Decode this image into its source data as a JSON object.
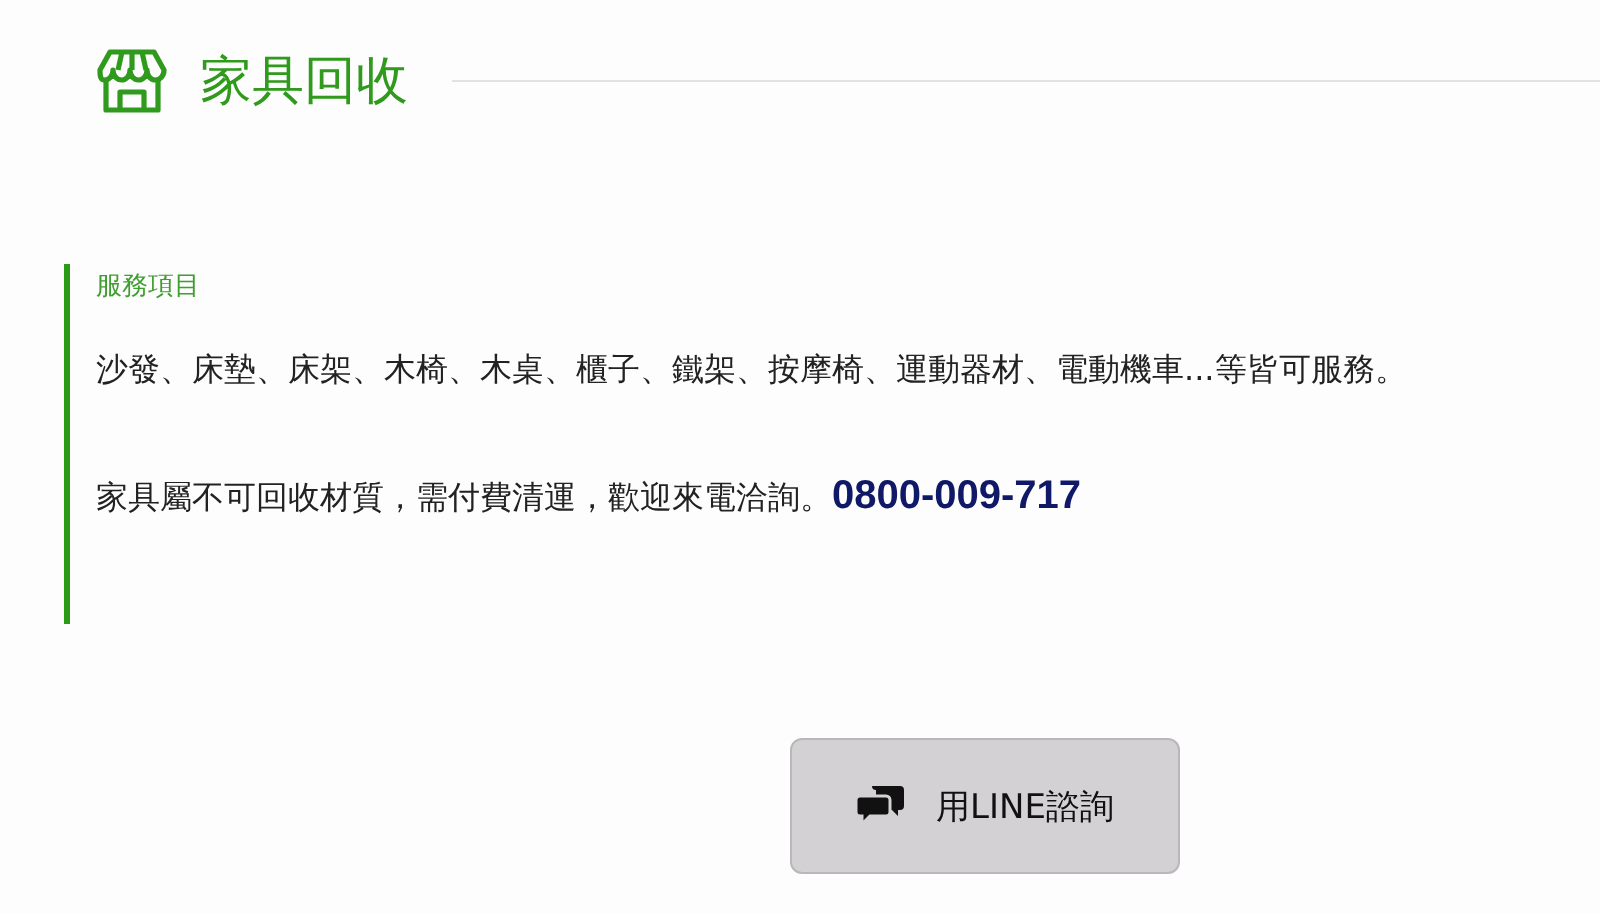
{
  "header": {
    "title": "家具回收"
  },
  "section": {
    "subtitle": "服務項目",
    "items_text": "沙發、床墊、床架、木椅、木桌、櫃子、鐵架、按摩椅、運動器材、電動機車...等皆可服務。",
    "note": "家具屬不可回收材質，需付費清運，歡迎來電洽詢。",
    "phone": "0800-009-717"
  },
  "button": {
    "label": "用LINE諮詢"
  }
}
